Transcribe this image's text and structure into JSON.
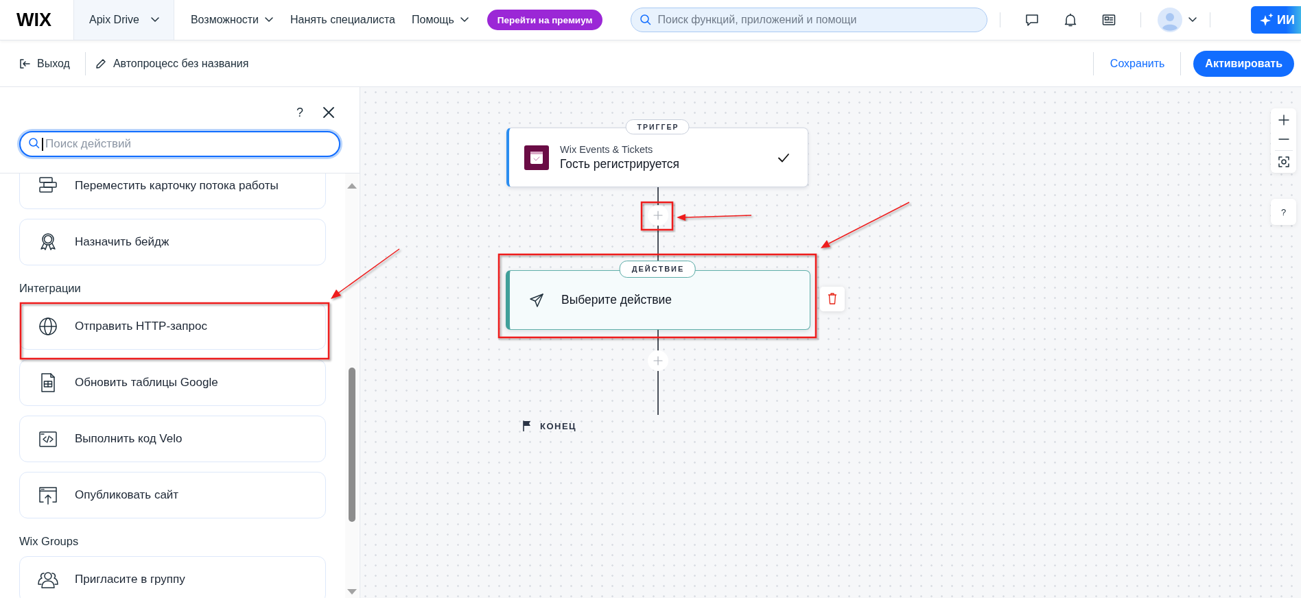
{
  "top_nav": {
    "logo": "WIX",
    "site": {
      "label": "Apix Drive",
      "has_menu": true
    },
    "menu": [
      {
        "label": "Возможности",
        "has_menu": true
      },
      {
        "label": "Нанять специалиста",
        "has_menu": false
      },
      {
        "label": "Помощь",
        "has_menu": true
      }
    ],
    "premium_button": "Перейти на премиум",
    "search": {
      "placeholder": "Поиск функций, приложений и помощи"
    },
    "ai_button": "ИИ"
  },
  "toolbar": {
    "exit": "Выход",
    "title": "Автопроцесс без названия",
    "save": "Сохранить",
    "activate": "Активировать"
  },
  "panel": {
    "help": "?",
    "search": {
      "placeholder": "Поиск действий",
      "focused": true
    },
    "sections": [
      {
        "items": [
          {
            "label": "Переместить карточку потока работы"
          },
          {
            "label": "Назначить бейдж"
          }
        ]
      },
      {
        "heading": "Интеграции",
        "items": [
          {
            "label": "Отправить HTTP-запрос"
          },
          {
            "label": "Обновить таблицы Google"
          },
          {
            "label": "Выполнить код Velo"
          },
          {
            "label": "Опубликовать сайт"
          }
        ]
      },
      {
        "heading": "Wix Groups",
        "items": [
          {
            "label": "Пригласите в группу"
          }
        ]
      }
    ]
  },
  "workflow": {
    "trigger": {
      "badge": "ТРИГГЕР",
      "app": "Wix Events & Tickets",
      "event": "Гость регистрируется",
      "done": true
    },
    "action": {
      "badge": "ДЕЙСТВИЕ",
      "label": "Выберите действие"
    },
    "end": "КОНЕЦ"
  },
  "canvas_controls": {
    "help": "?"
  }
}
